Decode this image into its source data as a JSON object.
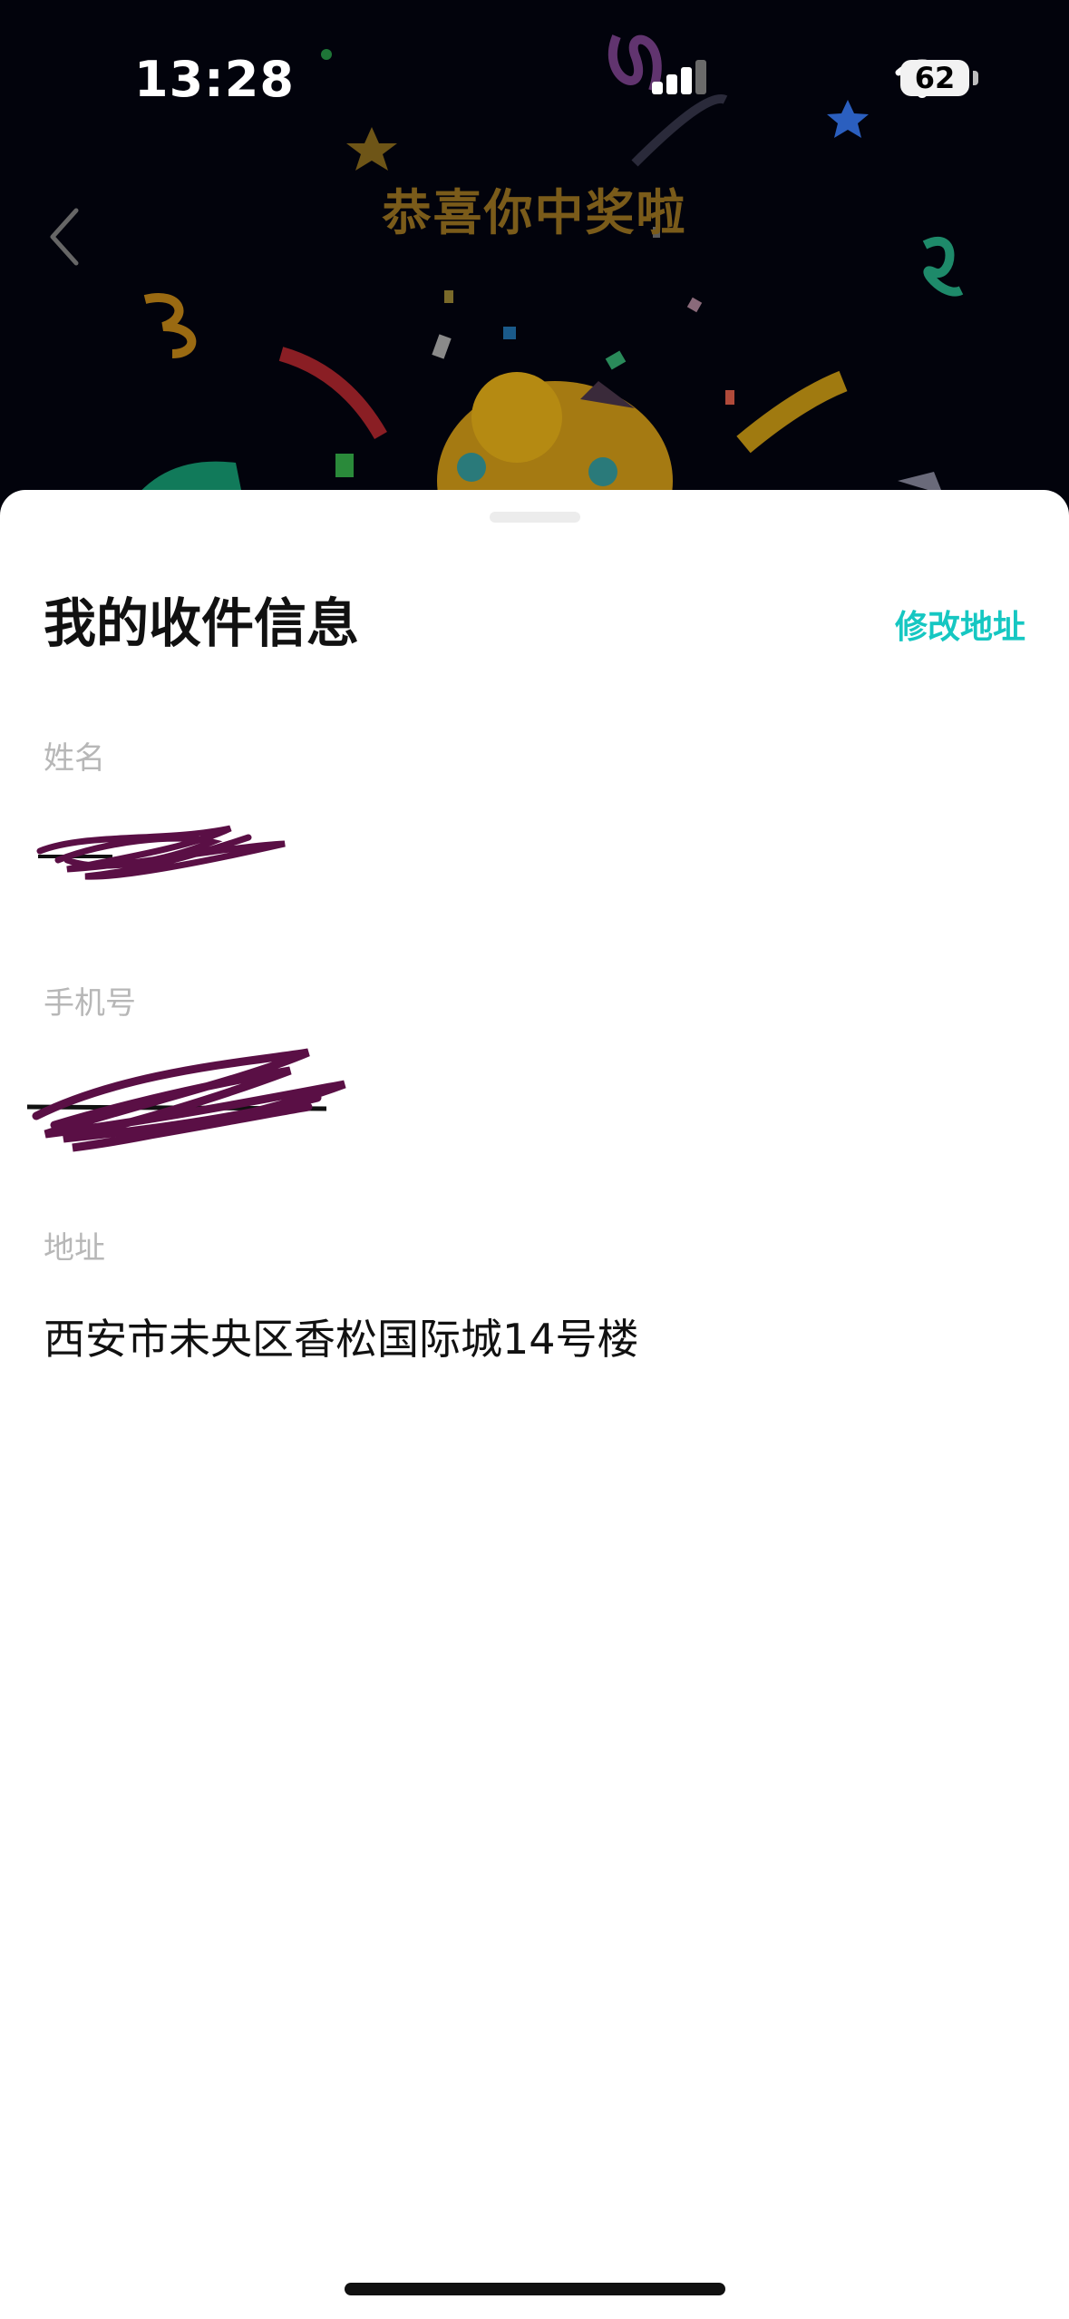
{
  "status_bar": {
    "time": "13:28",
    "battery": "62",
    "icons": [
      "cellular-signal-icon",
      "wifi-icon",
      "battery-icon"
    ]
  },
  "header": {
    "title": "恭喜你中奖啦",
    "back_icon": "chevron-left-icon"
  },
  "sheet": {
    "title": "我的收件信息",
    "edit_action": "修改地址",
    "fields": [
      {
        "label": "姓名",
        "value": "",
        "redacted": true
      },
      {
        "label": "手机号",
        "value": "",
        "redacted": true
      },
      {
        "label": "地址",
        "value": "西安市未央区香松国际城14号楼",
        "redacted": false
      }
    ]
  },
  "colors": {
    "accent": "#16c7c2",
    "redaction": "#5a0f45",
    "background_dark": "#02030c",
    "header_title": "#7a5b1a"
  }
}
